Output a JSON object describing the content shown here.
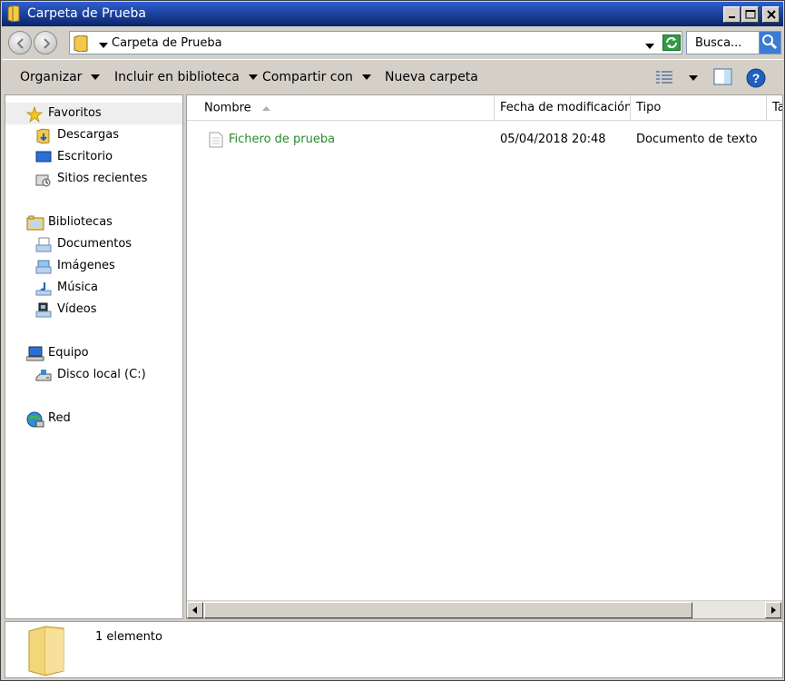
{
  "window": {
    "title": "Carpeta de Prueba"
  },
  "address": {
    "crumb": "Carpeta de Prueba",
    "search_placeholder": "Busca..."
  },
  "commands": {
    "organizar": "Organizar",
    "incluir": "Incluir en biblioteca",
    "compartir": "Compartir con",
    "nueva_carpeta": "Nueva carpeta"
  },
  "nav": {
    "favoritos": "Favoritos",
    "descargas": "Descargas",
    "escritorio": "Escritorio",
    "sitios": "Sitios recientes",
    "bibliotecas": "Bibliotecas",
    "documentos": "Documentos",
    "imagenes": "Imágenes",
    "musica": "Música",
    "videos": "Vídeos",
    "equipo": "Equipo",
    "disco": "Disco local (C:)",
    "red": "Red"
  },
  "columns": {
    "nombre": "Nombre",
    "fecha": "Fecha de modificación",
    "tipo": "Tipo",
    "tamano": "Ta"
  },
  "files": [
    {
      "name": "Fichero de prueba",
      "date": "05/04/2018 20:48",
      "type": "Documento de texto"
    }
  ],
  "details": {
    "count": "1 elemento"
  },
  "colors": {
    "titlebar": "#0a246a",
    "file_name": "#2a8a2a",
    "chrome": "#d4d0c8"
  }
}
